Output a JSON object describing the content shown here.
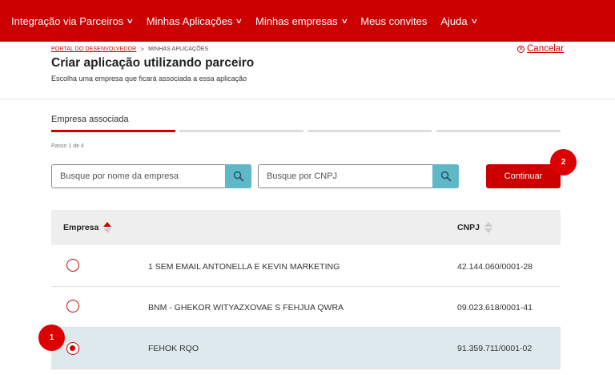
{
  "nav": {
    "items": [
      {
        "label": "Integração via Parceiros",
        "has_dropdown": true
      },
      {
        "label": "Minhas Aplicações",
        "has_dropdown": true
      },
      {
        "label": "Minhas empresas",
        "has_dropdown": true
      },
      {
        "label": "Meus convites",
        "has_dropdown": false
      },
      {
        "label": "Ajuda",
        "has_dropdown": true
      }
    ]
  },
  "breadcrumb": {
    "root": "PORTAL DO DESENVOLVEDOR",
    "separator": ">",
    "current": "MINHAS APLICAÇÕES"
  },
  "header": {
    "title": "Criar aplicação utilizando parceiro",
    "subtitle": "Escolha uma empresa que ficará associada a essa aplicação",
    "cancel_label": "Cancelar"
  },
  "stepper": {
    "active_label": "Empresa associada",
    "current": 1,
    "total": 4,
    "counter_text": "Passo 1 de 4"
  },
  "search": {
    "company_placeholder": "Busque por nome da empresa",
    "cnpj_placeholder": "Busque por CNPJ"
  },
  "actions": {
    "continue_label": "Continuar"
  },
  "annotations": {
    "badge_1": "1",
    "badge_2": "2"
  },
  "table": {
    "columns": {
      "company": "Empresa",
      "cnpj": "CNPJ"
    },
    "rows": [
      {
        "name": "1 SEM EMAIL ANTONELLA E KEVIN MARKETING",
        "cnpj": "42.144.060/0001-28",
        "selected": false
      },
      {
        "name": "BNM - GHEKOR WITYAZXOVAE S FEHJUA QWRA",
        "cnpj": "09.023.618/0001-41",
        "selected": false
      },
      {
        "name": "FEHOK RQO",
        "cnpj": "91.359.711/0001-02",
        "selected": true
      }
    ]
  },
  "colors": {
    "brand_red": "#cc0000",
    "search_button": "#5fb8c8",
    "selected_row": "#dde9ed"
  },
  "icons": {
    "dropdown": "chevron-down-icon",
    "search": "magnifier-icon",
    "cancel": "close-circle-icon",
    "sort": "sort-arrows-icon"
  }
}
